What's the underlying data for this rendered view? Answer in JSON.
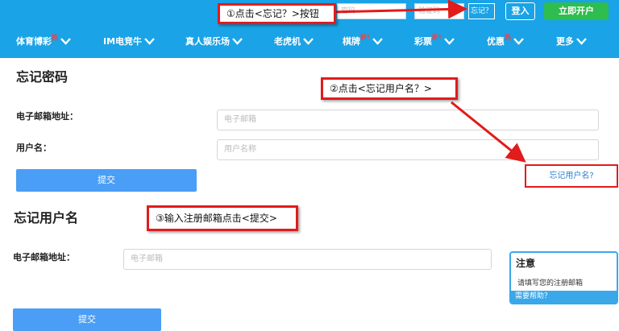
{
  "topbar": {
    "password_placeholder": "密码",
    "captcha_placeholder": "验证码",
    "forgot_link": "忘记？",
    "login_button": "登入",
    "register_button": "立即开户"
  },
  "nav": {
    "items": [
      {
        "label": "体育博彩",
        "hot": "热"
      },
      {
        "label": "IM电竞牛",
        "hot": ""
      },
      {
        "label": "真人娱乐场",
        "hot": ""
      },
      {
        "label": "老虎机",
        "hot": ""
      },
      {
        "label": "棋牌",
        "hot": "新!"
      },
      {
        "label": "彩票",
        "hot": "新!"
      },
      {
        "label": "优惠",
        "hot": "热"
      },
      {
        "label": "更多",
        "hot": ""
      }
    ]
  },
  "forgot_password": {
    "title": "忘记密码",
    "email_label": "电子邮箱地址：",
    "email_placeholder": "电子邮箱",
    "username_label": "用户名：",
    "username_placeholder": "用户名称",
    "submit_label": "提交",
    "forgot_username_link": "忘记用户名?"
  },
  "forgot_username": {
    "title": "忘记用户名",
    "email_label": "电子邮箱地址：",
    "email_placeholder": "电子邮箱",
    "submit_label": "提交"
  },
  "notice": {
    "title": "注意",
    "body": "请填写您的注册邮箱",
    "help": "需要帮助？"
  },
  "annotations": {
    "step1": "①点击<忘记？>按钮",
    "step2": "②点击<忘记用户名？>",
    "step3": "③输入注册邮箱点击<提交>"
  },
  "colors": {
    "header_blue": "#1aa3e6",
    "button_blue": "#4a9ef5",
    "register_green": "#2ebd4e",
    "annotation_red": "#e21b1b"
  }
}
